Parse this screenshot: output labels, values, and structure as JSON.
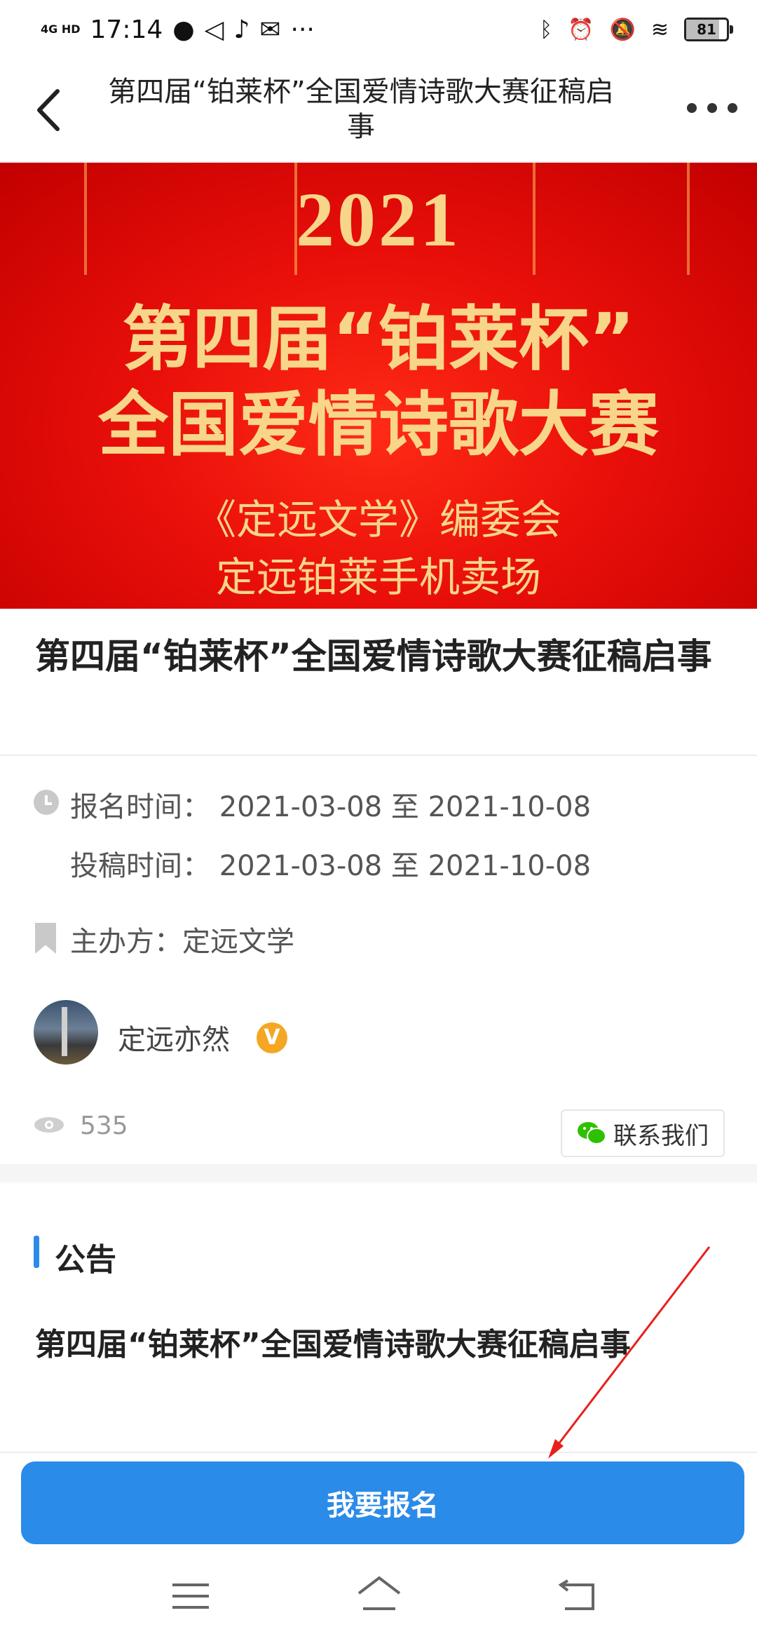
{
  "status_bar": {
    "network": "4G HD",
    "time": "17:14",
    "battery": "81",
    "battery_level": 0.81,
    "icons": [
      "wechat-icon",
      "mute-icon",
      "music-icon",
      "mail-icon",
      "more-notifications-icon",
      "bluetooth-icon",
      "alarm-icon",
      "dnd-icon",
      "wifi-icon",
      "battery-icon"
    ]
  },
  "header": {
    "title": "第四届“铂莱杯”全国爱情诗歌大赛征稿启事",
    "back_icon": "back-chevron-icon",
    "more_icon": "more-dots-icon"
  },
  "banner": {
    "year": "2021",
    "line1": "第四届“铂莱杯”",
    "line2": "全国爱情诗歌大赛",
    "line3": "《定远文学》编委会",
    "line4": "定远铂莱手机卖场",
    "colors": {
      "background": "#e90f0a",
      "text": "#f7d68a"
    }
  },
  "article": {
    "title": "第四届“铂莱杯”全国爱情诗歌大赛征稿启事",
    "signup_label": "报名时间：",
    "signup_time": "2021-03-08 至 2021-10-08",
    "submit_label": "投稿时间：",
    "submit_time": "2021-03-08 至 2021-10-08",
    "organizer": "主办方：定远文学"
  },
  "author": {
    "name": "定远亦然",
    "badge": "V"
  },
  "stats": {
    "views": "535",
    "contact_label": "联系我们"
  },
  "notice": {
    "label": "公告",
    "title": "第四届“铂莱杯”全国爱情诗歌大赛征稿启事"
  },
  "action": {
    "signup_button": "我要报名"
  },
  "accent_color": "#2b8be8"
}
